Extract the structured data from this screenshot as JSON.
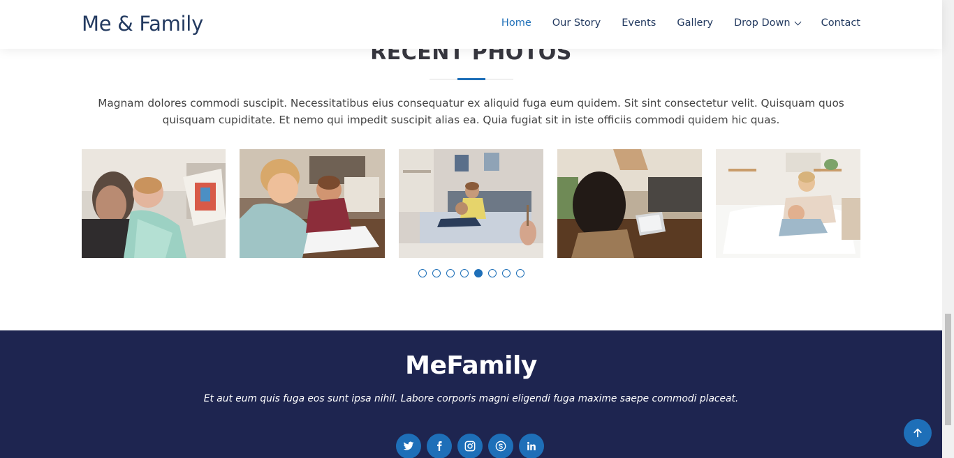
{
  "header": {
    "logo": "Me & Family",
    "nav": [
      {
        "label": "Home",
        "active": true
      },
      {
        "label": "Our Story"
      },
      {
        "label": "Events"
      },
      {
        "label": "Gallery"
      },
      {
        "label": "Drop Down"
      },
      {
        "label": "Contact"
      }
    ]
  },
  "section": {
    "title": "RECENT PHOTOS",
    "description": "Magnam dolores commodi suscipit. Necessitatibus eius consequatur ex aliquid fuga eum quidem. Sit sint consectetur velit. Quisquam quos quisquam cupiditate. Et nemo qui impedit suscipit alias ea. Quia fugiat sit in iste officiis commodi quidem hic quas."
  },
  "gallery": {
    "photos": [
      {
        "icon": "father-baby-photo"
      },
      {
        "icon": "kids-drawing-photo"
      },
      {
        "icon": "family-bed-photo"
      },
      {
        "icon": "woman-laptop-photo"
      },
      {
        "icon": "mother-child-sofa-photo"
      }
    ],
    "pagination": {
      "total": 8,
      "active": 5
    }
  },
  "footer": {
    "brand": "MeFamily",
    "tagline": "Et aut eum quis fuga eos sunt ipsa nihil. Labore corporis magni eligendi fuga maxime saepe commodi placeat.",
    "social": [
      "twitter-icon",
      "facebook-icon",
      "instagram-icon",
      "skype-icon",
      "linkedin-icon"
    ]
  },
  "colors": {
    "accent": "#1e6fb8",
    "navy": "#1e2550",
    "heading": "#233a60"
  }
}
